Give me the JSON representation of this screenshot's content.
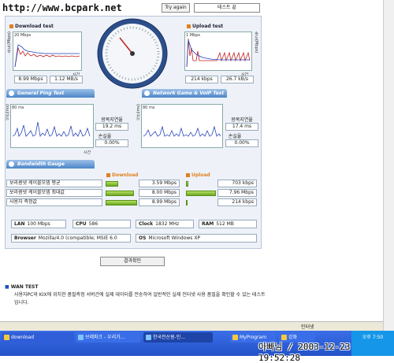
{
  "watermark": "http://www.bcpark.net",
  "top": {
    "try_again": "Try again",
    "title_box": "테스트 끝"
  },
  "download": {
    "title": "Download test",
    "scale": "20 Mbps",
    "xlabel": "시간",
    "ylabel": "속도(Mbps)",
    "val1": "8.99 Mbps",
    "val2": "1.12 MB/s"
  },
  "upload": {
    "title": "Upload test",
    "scale": "1 Mbps",
    "xlabel": "시간",
    "ylabel": "속도(Mbps)",
    "val1": "214 kbps",
    "val2": "26.7 kB/s"
  },
  "sections": {
    "ping": "General Ping Test",
    "game": "Network Game & VoIP Test",
    "gauge": "Bandwidth Gauge"
  },
  "ping": {
    "scale": "80 ms",
    "xlabel": "시간",
    "ylabel": "시간(ms)",
    "rtt_label": "왕복지연율",
    "rtt": "19.2 ms",
    "loss_label": "손실율",
    "loss": "0.00%"
  },
  "game": {
    "scale": "80 ms",
    "ylabel": "시간(ms)",
    "rtt_label": "왕복지연율",
    "rtt": "17.4 ms",
    "loss_label": "손실율",
    "loss": "0.00%"
  },
  "gauge": {
    "down_head": "Download",
    "up_head": "Upload",
    "rows": [
      {
        "label": "보라콤넷 케이블모뎀 평균",
        "down": "3.59 Mbps",
        "down_frac": 0.4,
        "up": "703 kbps",
        "up_frac": 0.09
      },
      {
        "label": "보라콤넷 케이블모뎀 최대값",
        "down": "8.00 Mbps",
        "down_frac": 0.89,
        "up": "7.96 Mbps",
        "up_frac": 1.0
      },
      {
        "label": "사용자 측정값",
        "down": "8.99 Mbps",
        "down_frac": 1.0,
        "up": "214 kbps",
        "up_frac": 0.03
      }
    ]
  },
  "info": {
    "lan_k": "LAN",
    "lan_v": "100 Mbps",
    "cpu_k": "CPU",
    "cpu_v": "586",
    "clock_k": "Clock",
    "clock_v": "1832 MHz",
    "ram_k": "RAM",
    "ram_v": "512 MB",
    "browser_k": "Browser",
    "browser_v": "Mozilla/4.0 (compatible; MSIE 6.0",
    "os_k": "OS",
    "os_v": "Microsoft Windows XP"
  },
  "result_button": "결과확인",
  "wan": {
    "title": "WAN TEST",
    "desc": "사용자PC와 KIX에 위치한 품질측정 서버간에 실제 데이터를 전송하여 일반적인 실제 인터넷 사용 품질을 확인할 수 있는 테스트입니다."
  },
  "status": {
    "zone": "인터넷"
  },
  "taskbar": {
    "items": [
      "download",
      "브레파크 - 우리가...",
      "한국전산원-인...",
      "MyProgram",
      "강좌"
    ],
    "time": "오후 7:50"
  },
  "stamp": "아빠님 / 2003-12-23 19:52:28",
  "colors": {
    "accent": "#4c86c8",
    "bar": "#8cc43c",
    "download": "#e08020",
    "upload": "#e08020"
  }
}
